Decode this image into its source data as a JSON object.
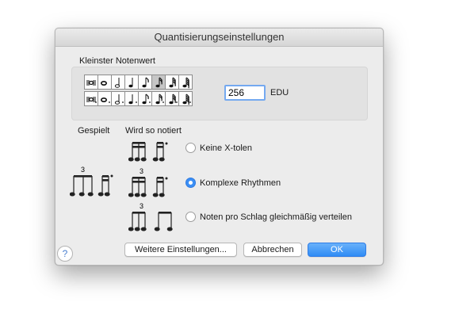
{
  "window": {
    "title": "Quantisierungseinstellungen"
  },
  "smallest_note": {
    "label": "Kleinster Notenwert",
    "row1": [
      "breve",
      "whole",
      "half",
      "quarter",
      "eighth",
      "sixteenth",
      "thirtysecond",
      "sixtyfourth"
    ],
    "row2": [
      "breve-dotted",
      "whole-dotted",
      "half-dotted",
      "quarter-dotted",
      "eighth-dotted",
      "sixteenth-dotted",
      "thirtysecond-dotted",
      "sixtyfourth-dotted"
    ],
    "selected": "sixteenth",
    "edu_value": "256",
    "edu_unit": "EDU"
  },
  "played": {
    "label": "Gespielt",
    "tuplet_number": "3"
  },
  "notated": {
    "label": "Wird so notiert",
    "options": [
      {
        "label": "Keine X-tolen",
        "selected": false
      },
      {
        "label": "Komplexe Rhythmen",
        "selected": true,
        "tuplet_number": "3"
      },
      {
        "label": "Noten pro Schlag gleichmäßig verteilen",
        "selected": false,
        "tuplet_number": "3"
      }
    ]
  },
  "buttons": {
    "more": "Weitere Einstellungen...",
    "cancel": "Abbrechen",
    "ok": "OK",
    "help": "?"
  },
  "colors": {
    "accent": "#3b8ff5",
    "dialog_bg": "#ececec",
    "group_bg": "#e2e2e2"
  }
}
